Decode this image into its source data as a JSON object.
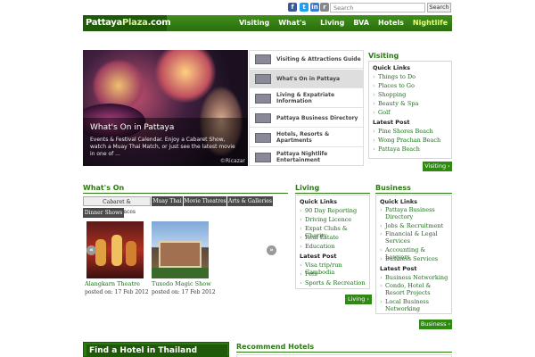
{
  "search": {
    "placeholder": "Search",
    "button": "Search"
  },
  "logo": {
    "part1": "Pattaya",
    "part2": "Plaza",
    ".com": ".com"
  },
  "nav": [
    "Visiting",
    "What's On",
    "Living",
    "BVA",
    "Hotels",
    "Nightlife"
  ],
  "slider": {
    "title": "What's On in Pattaya",
    "text": "Events & Festival Calendar. Enjoy a Cabaret Show, watch a Muay Thai Match, or just see the latest movie in one of ...",
    "credit": "©Ricazar"
  },
  "slideTabs": [
    "Visiting & Attractions Guide",
    "What's On in Pattaya",
    "Living & Expatriate Information",
    "Pattaya Business Directory",
    "Hotels, Resorts & Apartments",
    "Pattaya Nightlife Entertainment"
  ],
  "visiting": {
    "title": "Visiting",
    "quick": "Quick Links",
    "links": [
      "Things to Do",
      "Places to Go",
      "Shopping",
      "Beauty & Spa",
      "Golf"
    ],
    "latest": "Latest Post",
    "posts": [
      "Pine Shores Beach",
      "Wong Prachan Beach",
      "Pattaya Beach"
    ],
    "button": "Visiting ›"
  },
  "whatson": {
    "title": "What's On",
    "tabs": [
      "Cabaret & Performances",
      "Muay Thai",
      "Movie Theatres",
      "Arts & Galleries",
      "Dinner Shows"
    ],
    "items": [
      {
        "name": "Alangkarn Theatre",
        "date": "posted on: 17 Feb 2012"
      },
      {
        "name": "Tuxedo Magic Show",
        "date": "posted on: 17 Feb 2012"
      }
    ],
    "prev": "«",
    "next": "»"
  },
  "living": {
    "title": "Living",
    "quick": "Quick Links",
    "links": [
      "90 Day Reporting",
      "Driving Licence",
      "Expat Clubs & Charity",
      "Real Estate",
      "Education"
    ],
    "latest": "Latest Post",
    "posts": [
      "Visa trip/run Cambodia",
      "Pets",
      "Sports & Recreation"
    ],
    "button": "Living ›"
  },
  "business": {
    "title": "Business",
    "quick": "Quick Links",
    "links": [
      "Pattaya Business Directory",
      "Jobs & Recruitment",
      "Financial & Legal Services",
      "Accounting & Lawyers",
      "Business Services"
    ],
    "latest": "Latest Post",
    "posts": [
      "Business Networking",
      "Condo, Hotel & Resort Projects",
      "Local Business Networking"
    ],
    "button": "Business ›"
  },
  "bottom": {
    "findHotel": "Find a Hotel in Thailand",
    "recommend": "Recommend Hotels"
  }
}
